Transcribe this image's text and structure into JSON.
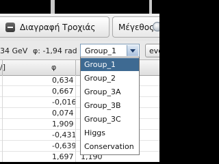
{
  "toolbar": {
    "delete_track_label": "Διαγραφή Τροχιάς",
    "size_label": "Μέγεθος"
  },
  "status": {
    "energy_text": "34 GeV",
    "phi_text": "φ: -1,94 rad",
    "group_selected": "Group_1",
    "event_button_label": "eve"
  },
  "group_options": [
    "Group_1",
    "Group_2",
    "Group_3A",
    "Group_3B",
    "Group_3C",
    "Higgs",
    "Conservation"
  ],
  "table": {
    "left_header": "/]",
    "phi_header": "φ",
    "phi_values": [
      "0,634",
      "0,667",
      "-0,016",
      "0,074",
      "1,909",
      "-0,431",
      "-0,639",
      "1,697"
    ],
    "extra_values": [
      "",
      "",
      "",
      "",
      "",
      "",
      "",
      "1,190"
    ]
  },
  "colors": {
    "selection": "#3e6a92",
    "toolbar_bg": "#ececec",
    "combo_border": "#7f9db9"
  }
}
